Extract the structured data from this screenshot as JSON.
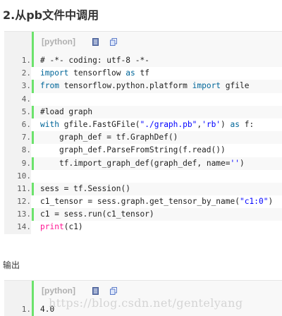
{
  "heading": "2.从pb文件中调用",
  "block1": {
    "language": "[python]",
    "lines": [
      {
        "num": "1.",
        "text": "# -*- coding: utf-8 -*-"
      },
      {
        "num": "2.",
        "text": "import tensorflow as tf"
      },
      {
        "num": "3.",
        "text": "from tensorflow.python.platform import gfile"
      },
      {
        "num": "4.",
        "text": ""
      },
      {
        "num": "5.",
        "text": "#load graph"
      },
      {
        "num": "6.",
        "text": "with gfile.FastGFile(\"./graph.pb\",'rb') as f:"
      },
      {
        "num": "7.",
        "text": "    graph_def = tf.GraphDef()"
      },
      {
        "num": "8.",
        "text": "    graph_def.ParseFromString(f.read())"
      },
      {
        "num": "9.",
        "text": "    tf.import_graph_def(graph_def, name='')"
      },
      {
        "num": "10.",
        "text": ""
      },
      {
        "num": "11.",
        "text": "sess = tf.Session()"
      },
      {
        "num": "12.",
        "text": "c1_tensor = sess.graph.get_tensor_by_name(\"c1:0\")"
      },
      {
        "num": "13.",
        "text": "c1 = sess.run(c1_tensor)"
      },
      {
        "num": "14.",
        "text": "print(c1)"
      }
    ]
  },
  "output_label": "输出",
  "block2": {
    "language": "[python]",
    "lines": [
      {
        "num": "1.",
        "text": "4.0"
      }
    ]
  },
  "watermark": "https://blog.csdn.net/gentelyang",
  "icons": {
    "view_source": "view-source-icon",
    "copy": "copy-icon"
  },
  "colors": {
    "gutter_bar": "#6ce26c",
    "keyword": "#006699",
    "comment": "#008200",
    "string": "#0000ff"
  }
}
